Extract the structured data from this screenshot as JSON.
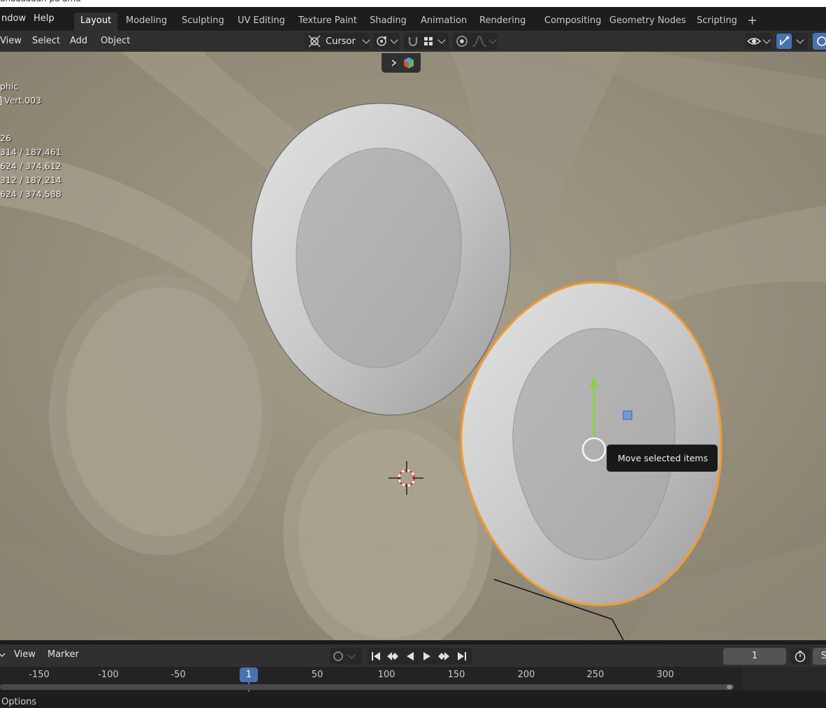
{
  "menubar": {
    "items": [
      "ndow",
      "Help"
    ],
    "workspaces": [
      "Layout",
      "Modeling",
      "Sculpting",
      "UV Editing",
      "Texture Paint",
      "Shading",
      "Animation",
      "Rendering",
      "Compositing",
      "Geometry Nodes",
      "Scripting"
    ],
    "active_workspace": "Layout",
    "add_label": "+"
  },
  "header": {
    "menus": [
      "View",
      "Select",
      "Add",
      "Object"
    ],
    "pivot_label": "Cursor",
    "gizmo_toggle_color": "#4772b3"
  },
  "viewport": {
    "overlay": {
      "view_mode": "phic",
      "object_name": "Vert.003",
      "stats": [
        "26",
        "314 / 187,461",
        "624 / 374,612",
        "312 / 187,214",
        "624 / 374,588"
      ]
    },
    "tooltip": "Move selected items",
    "selection_color": "#f29a2e",
    "gizmo_axis_color": "#8cd044"
  },
  "timeline": {
    "menus": [
      "View",
      "Marker"
    ],
    "current_frame": "1",
    "scene_label": "S",
    "ticks": [
      "-150",
      "-100",
      "-50",
      "1",
      "50",
      "100",
      "150",
      "200",
      "250",
      "300"
    ],
    "playhead_color": "#4772b3"
  },
  "status_bar": {
    "label": "Options"
  }
}
